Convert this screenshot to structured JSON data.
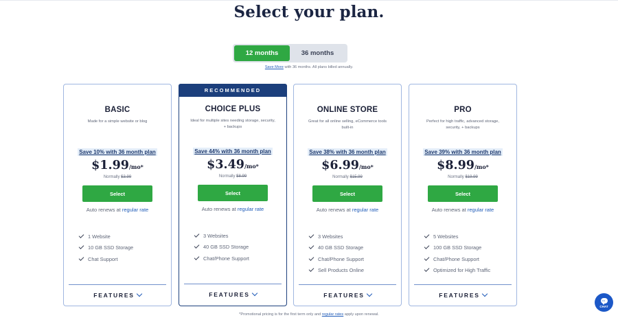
{
  "page": {
    "title": "Select your plan."
  },
  "term_toggle": {
    "options": [
      {
        "label": "12 months",
        "active": true
      },
      {
        "label": "36 months",
        "active": false
      }
    ],
    "note_link": "Save More",
    "note_text": " with 36 months. All plans billed annually."
  },
  "plans": [
    {
      "name": "BASIC",
      "banner": "",
      "description": "Made for a simple website or blog",
      "save_text": "Save 10% with 36 month plan",
      "price": "$1.99",
      "price_unit": "/mo*",
      "normal_label": "Normally ",
      "normal_price": "$3.99",
      "select_label": "Select",
      "renew_text": "Auto renews at ",
      "renew_link": "regular rate",
      "features": [
        "1 Website",
        "10 GB SSD Storage",
        "Chat Support"
      ],
      "features_toggle": "FEATURES"
    },
    {
      "name": "CHOICE PLUS",
      "banner": "RECOMMENDED",
      "description": "Ideal for multiple sites needing storage, security, + backups",
      "save_text": "Save 44% with 36 month plan",
      "price": "$3.49",
      "price_unit": "/mo*",
      "normal_label": "Normally ",
      "normal_price": "$8.99",
      "select_label": "Select",
      "renew_text": "Auto renews at ",
      "renew_link": "regular rate",
      "features": [
        "3 Websites",
        "40 GB SSD Storage",
        "Chat/Phone Support"
      ],
      "features_toggle": "FEATURES"
    },
    {
      "name": "ONLINE STORE",
      "banner": "",
      "description": "Great for all online selling, eCommerce tools built-in",
      "save_text": "Save 38% with 36 month plan",
      "price": "$6.99",
      "price_unit": "/mo*",
      "normal_label": "Normally ",
      "normal_price": "$15.99",
      "select_label": "Select",
      "renew_text": "Auto renews at ",
      "renew_link": "regular rate",
      "features": [
        "3 Websites",
        "40 GB SSD Storage",
        "Chat/Phone Support",
        "Sell Products Online"
      ],
      "features_toggle": "FEATURES"
    },
    {
      "name": "PRO",
      "banner": "",
      "description": "Perfect for high traffic, advanced storage, security, + backups",
      "save_text": "Save 39% with 36 month plan",
      "price": "$8.99",
      "price_unit": "/mo*",
      "normal_label": "Normally ",
      "normal_price": "$19.99",
      "select_label": "Select",
      "renew_text": "Auto renews at ",
      "renew_link": "regular rate",
      "features": [
        "5 Websites",
        "100 GB SSD Storage",
        "Chat/Phone Support",
        "Optimized for High Traffic"
      ],
      "features_toggle": "FEATURES"
    }
  ],
  "footnote": {
    "before": "*Promotional pricing is for the first term only and ",
    "link": "regular rates",
    "after": " apply upon renewal."
  },
  "chat": {
    "label": "CHAT",
    "icon": "chat-bubble-icon"
  },
  "colors": {
    "accent_green": "#2fa843",
    "brand_navy": "#1c3f7c",
    "link_blue": "#1f5bb8",
    "card_border": "#9fb6e0"
  }
}
